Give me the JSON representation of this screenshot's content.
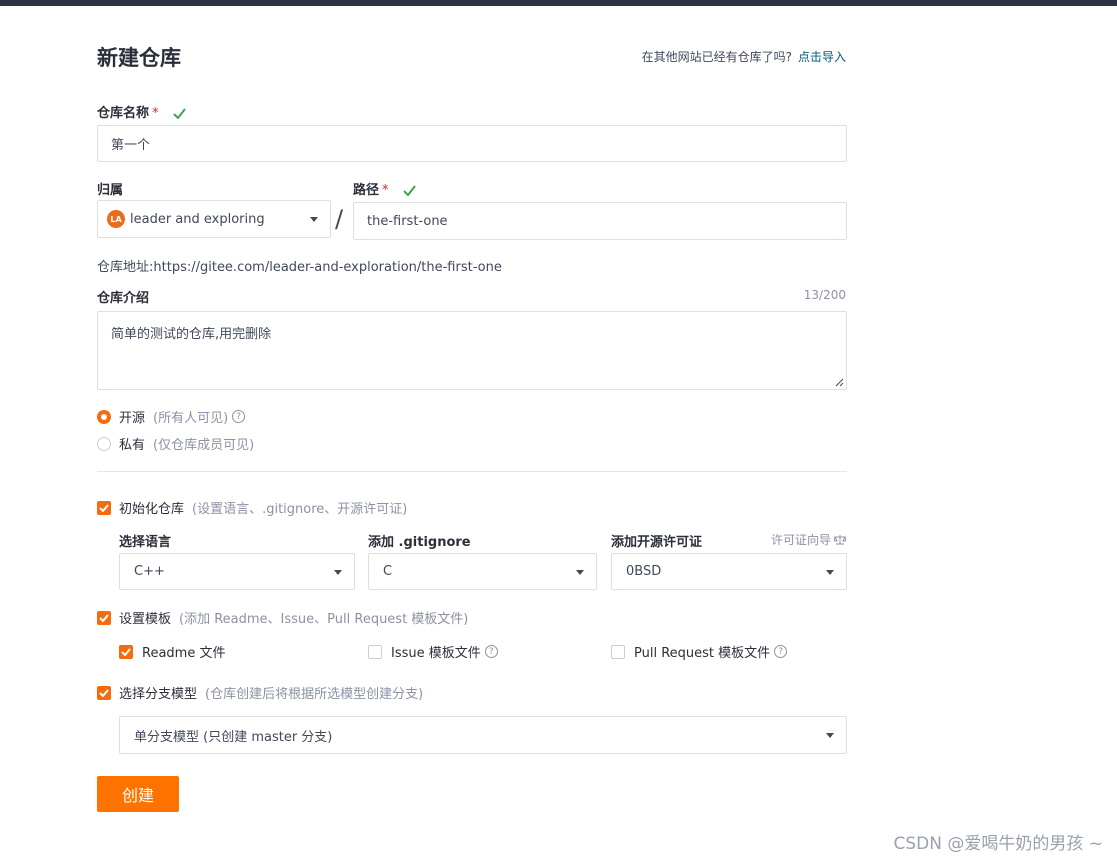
{
  "title": "新建仓库",
  "import": {
    "text": "在其他网站已经有仓库了吗?",
    "link": "点击导入"
  },
  "repo_name": {
    "label": "仓库名称",
    "required": "*",
    "value": "第一个"
  },
  "owner": {
    "label": "归属",
    "avatar": "LA",
    "value": "leader and exploring"
  },
  "separator": "/",
  "path": {
    "label": "路径",
    "required": "*",
    "value": "the-first-one"
  },
  "repo_url": "仓库地址:https://gitee.com/leader-and-exploration/the-first-one",
  "description": {
    "label": "仓库介绍",
    "counter": "13/200",
    "value": "简单的测试的仓库,用完删除"
  },
  "visibility": {
    "public": {
      "label": "开源",
      "hint": "(所有人可见)"
    },
    "private": {
      "label": "私有",
      "hint": "(仅仓库成员可见)"
    }
  },
  "init": {
    "label": "初始化仓库",
    "hint": "(设置语言、.gitignore、开源许可证)"
  },
  "language": {
    "label": "选择语言",
    "value": "C++"
  },
  "gitignore": {
    "label": "添加 .gitignore",
    "value": "C"
  },
  "license": {
    "label": "添加开源许可证",
    "guide": "许可证向导",
    "value": "0BSD"
  },
  "template": {
    "label": "设置模板",
    "hint": "(添加 Readme、Issue、Pull Request 模板文件)"
  },
  "readme": {
    "label": "Readme 文件"
  },
  "issue": {
    "label": "Issue 模板文件"
  },
  "pr": {
    "label": "Pull Request 模板文件"
  },
  "branch": {
    "label": "选择分支模型",
    "hint": "(仓库创建后将根据所选模型创建分支)",
    "value": "单分支模型 (只创建 master 分支)"
  },
  "create_label": "创建",
  "watermark": "CSDN @爱喝牛奶的男孩 ~",
  "colors": {
    "accent": "#fe7300",
    "link": "#005980",
    "check": "#3aa64f"
  }
}
